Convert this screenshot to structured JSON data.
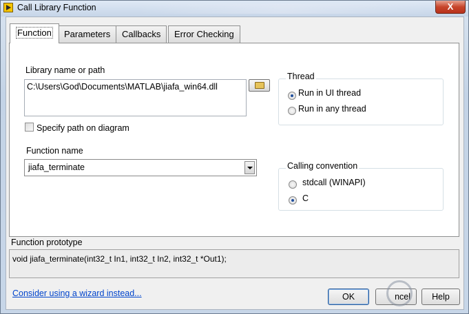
{
  "window": {
    "title": "Call Library Function",
    "close_symbol": "X"
  },
  "tabs": [
    {
      "label": "Function",
      "active": true
    },
    {
      "label": "Parameters",
      "active": false
    },
    {
      "label": "Callbacks",
      "active": false
    },
    {
      "label": "Error Checking",
      "active": false
    }
  ],
  "library": {
    "label": "Library name or path",
    "value": "C:\\Users\\God\\Documents\\MATLAB\\jiafa_win64.dll",
    "browse_icon": "folder-open-icon"
  },
  "specify_path": {
    "label": "Specify path on diagram",
    "checked": false
  },
  "function_name": {
    "label": "Function name",
    "value": "jiafa_terminate"
  },
  "thread": {
    "title": "Thread",
    "options": [
      {
        "label": "Run in UI thread",
        "selected": true
      },
      {
        "label": "Run in any thread",
        "selected": false
      }
    ]
  },
  "calling_convention": {
    "title": "Calling convention",
    "options": [
      {
        "label": "stdcall (WINAPI)",
        "selected": false
      },
      {
        "label": "C",
        "selected": true
      }
    ]
  },
  "prototype": {
    "label": "Function prototype",
    "value": "void  jiafa_terminate(int32_t In1, int32_t In2, int32_t *Out1);"
  },
  "footer": {
    "wizard_link": "Consider using a wizard instead...",
    "ok_label": "OK",
    "cancel_label": "ncel",
    "help_label": "Help"
  },
  "colors": {
    "link": "#0044cc",
    "radio_dot": "#1f4e9c",
    "close_button": "#c7452b"
  }
}
